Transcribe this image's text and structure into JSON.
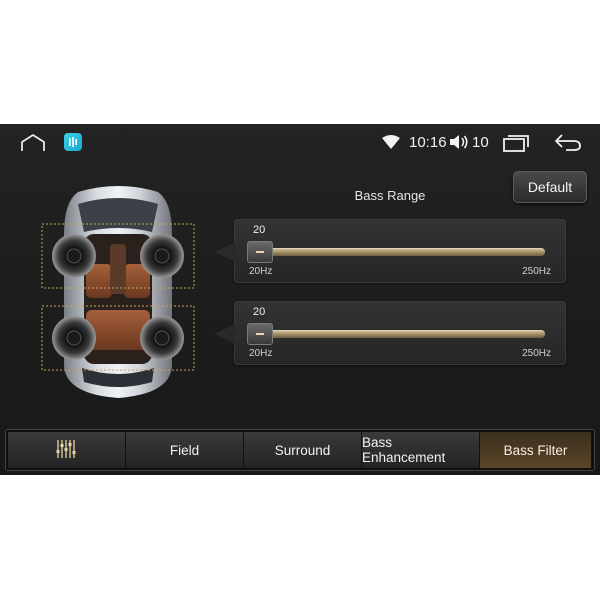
{
  "status_bar": {
    "time": "10:16",
    "volume": "10"
  },
  "header": {
    "default_label": "Default",
    "bass_range_label": "Bass Range"
  },
  "sliders": [
    {
      "value": "20",
      "fraction": 0.0,
      "min_label": "20Hz",
      "max_label": "250Hz"
    },
    {
      "value": "20",
      "fraction": 0.0,
      "min_label": "20Hz",
      "max_label": "250Hz"
    }
  ],
  "tabs": [
    {
      "icon": "equalizer-icon",
      "label": ""
    },
    {
      "label": "Field"
    },
    {
      "label": "Surround"
    },
    {
      "label": "Bass Enhancement"
    },
    {
      "label": "Bass Filter",
      "active": true
    }
  ],
  "colors": {
    "accent": "#9a8760",
    "active_tab": "#5a4526",
    "app_icon": "#39d3ea"
  }
}
